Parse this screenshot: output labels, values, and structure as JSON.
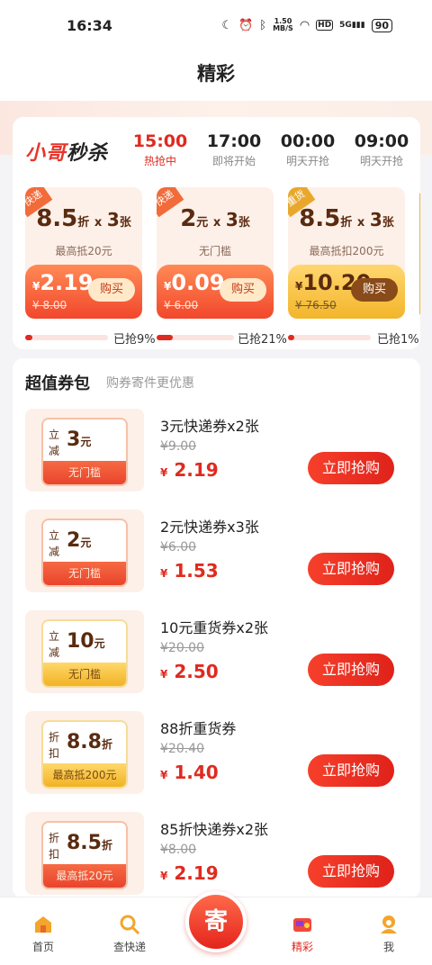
{
  "status": {
    "time": "16:34",
    "speed_top": "1.50",
    "speed_bottom": "MB/S",
    "hd": "HD",
    "signal": "5G",
    "battery": "90"
  },
  "page_title": "精彩",
  "flash": {
    "logo_a": "小哥",
    "logo_b": "秒杀",
    "slots": [
      {
        "time": "15:00",
        "status": "热抢中"
      },
      {
        "time": "17:00",
        "status": "即将开始"
      },
      {
        "time": "00:00",
        "status": "明天开抢"
      },
      {
        "time": "09:00",
        "status": "明天开抢"
      }
    ],
    "cards": [
      {
        "tag": "快递",
        "big": "8.5",
        "unit": "折",
        "x": "x",
        "count": "3",
        "count_unit": "张",
        "limit": "最高抵20元",
        "currency": "¥",
        "price": "2.19",
        "old": "¥ 8.00",
        "buy": "购买"
      },
      {
        "tag": "快递",
        "big": "2",
        "unit": "元",
        "x": "x",
        "count": "3",
        "count_unit": "张",
        "limit": "无门槛",
        "currency": "¥",
        "price": "0.09",
        "old": "¥ 6.00",
        "buy": "购买"
      },
      {
        "tag": "重货",
        "big": "8.5",
        "unit": "折",
        "x": "x",
        "count": "3",
        "count_unit": "张",
        "limit": "最高抵扣200元",
        "currency": "¥",
        "price": "10.20",
        "old": "¥ 76.50",
        "buy": "购买"
      }
    ],
    "progress": [
      {
        "fraction": 0.09,
        "label": "已抢9%"
      },
      {
        "fraction": 0.21,
        "label": "已抢21%"
      },
      {
        "fraction": 0.01,
        "label": "已抢1%"
      }
    ]
  },
  "package": {
    "title": "超值券包",
    "subtitle": "购券寄件更优惠",
    "items": [
      {
        "lbl": "立减",
        "amount": "3",
        "amount_unit": "元",
        "band": "无门槛",
        "name": "3元快递券x2张",
        "old": "¥9.00",
        "currency": "¥",
        "price": "2.19",
        "button": "立即抢购"
      },
      {
        "lbl": "立减",
        "amount": "2",
        "amount_unit": "元",
        "band": "无门槛",
        "name": "2元快递券x3张",
        "old": "¥6.00",
        "currency": "¥",
        "price": "1.53",
        "button": "立即抢购"
      },
      {
        "lbl": "立减",
        "amount": "10",
        "amount_unit": "元",
        "band": "无门槛",
        "name": "10元重货券x2张",
        "old": "¥20.00",
        "currency": "¥",
        "price": "2.50",
        "button": "立即抢购"
      },
      {
        "lbl": "折扣",
        "amount": "8.8",
        "amount_unit": "折",
        "band": "最高抵200元",
        "name": "88折重货券",
        "old": "¥20.40",
        "currency": "¥",
        "price": "1.40",
        "button": "立即抢购"
      },
      {
        "lbl": "折扣",
        "amount": "8.5",
        "amount_unit": "折",
        "band": "最高抵20元",
        "name": "85折快递券x2张",
        "old": "¥8.00",
        "currency": "¥",
        "price": "2.19",
        "button": "立即抢购"
      }
    ]
  },
  "nav": {
    "home": "首页",
    "track": "查快递",
    "send": "寄",
    "featured": "精彩",
    "me": "我"
  },
  "colors": {
    "accent": "#e02a1f",
    "gold": "#f3b52a"
  }
}
